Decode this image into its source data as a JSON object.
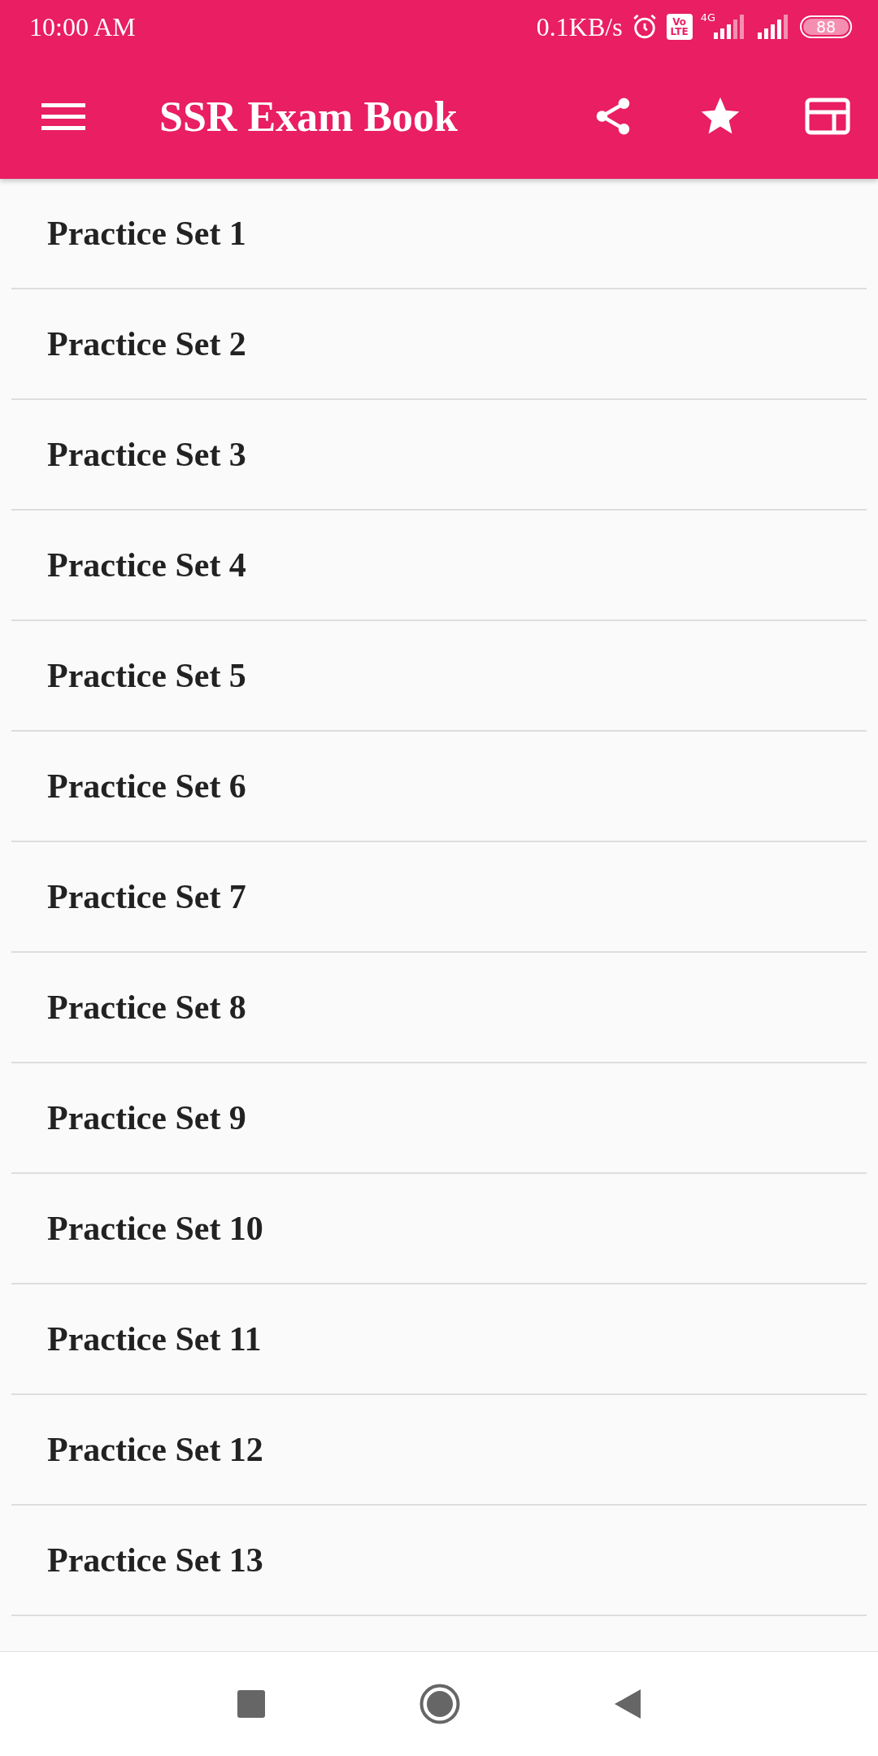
{
  "status_bar": {
    "time": "10:00 AM",
    "speed": "0.1KB/s",
    "volte_top": "Vo",
    "volte_bottom": "LTE",
    "network": "4G",
    "battery": "88"
  },
  "app_bar": {
    "title": "SSR Exam Book"
  },
  "list": [
    {
      "label": "Practice Set 1"
    },
    {
      "label": "Practice Set 2"
    },
    {
      "label": "Practice Set 3"
    },
    {
      "label": "Practice Set 4"
    },
    {
      "label": "Practice Set 5"
    },
    {
      "label": "Practice Set 6"
    },
    {
      "label": "Practice Set 7"
    },
    {
      "label": "Practice Set 8"
    },
    {
      "label": "Practice Set 9"
    },
    {
      "label": "Practice Set 10"
    },
    {
      "label": "Practice Set 11"
    },
    {
      "label": "Practice Set 12"
    },
    {
      "label": "Practice Set 13"
    }
  ]
}
